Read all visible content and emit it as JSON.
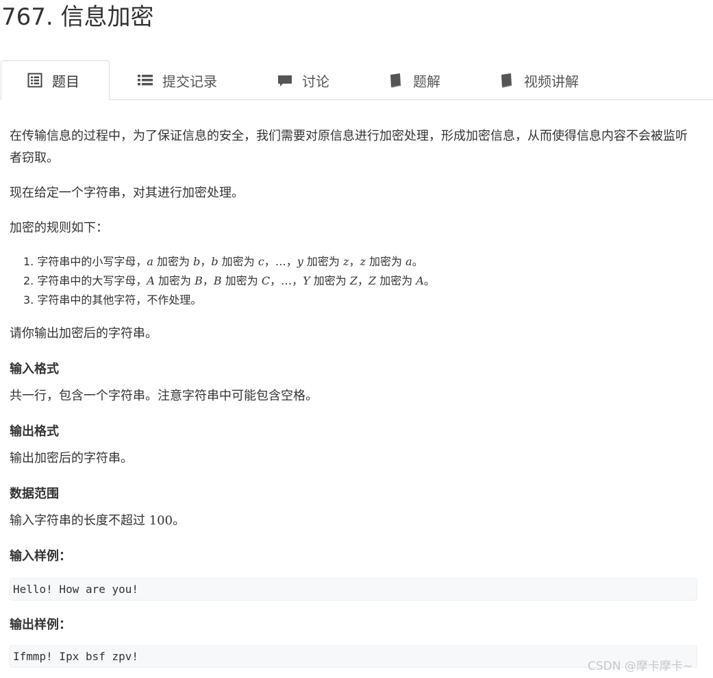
{
  "problem": {
    "title": "767. 信息加密"
  },
  "tabs": [
    {
      "label": "题目",
      "icon": "list-alt-icon",
      "active": true
    },
    {
      "label": "提交记录",
      "icon": "list-icon",
      "active": false
    },
    {
      "label": "讨论",
      "icon": "comment-icon",
      "active": false
    },
    {
      "label": "题解",
      "icon": "book-icon",
      "active": false
    },
    {
      "label": "视频讲解",
      "icon": "book-icon",
      "active": false
    }
  ],
  "description": {
    "p1": "在传输信息的过程中，为了保证信息的安全，我们需要对原信息进行加密处理，形成加密信息，从而使得信息内容不会被监听者窃取。",
    "p2": "现在给定一个字符串，对其进行加密处理。",
    "p3": "加密的规则如下：",
    "rules": [
      {
        "num": "1.",
        "prefix": "字符串中的小写字母，",
        "a": "a",
        "t1": " 加密为 ",
        "b": "b",
        "sep1": "，",
        "b2": "b",
        "t2": " 加密为 ",
        "c": "c",
        "dots": "，…，",
        "y": "y",
        "t3": " 加密为 ",
        "z": "z",
        "sep2": "，",
        "z2": "z",
        "t4": " 加密为 ",
        "a2": "a",
        "end": "。"
      },
      {
        "num": "2.",
        "prefix": "字符串中的大写字母，",
        "a": "A",
        "t1": " 加密为 ",
        "b": "B",
        "sep1": "，",
        "b2": "B",
        "t2": " 加密为 ",
        "c": "C",
        "dots": "，…，",
        "y": "Y",
        "t3": " 加密为 ",
        "z": "Z",
        "sep2": "，",
        "z2": "Z",
        "t4": " 加密为 ",
        "a2": "A",
        "end": "。"
      },
      {
        "num": "3.",
        "text": "字符串中的其他字符，不作处理。"
      }
    ],
    "p4": "请你输出加密后的字符串。"
  },
  "input_format": {
    "heading": "输入格式",
    "text": "共一行，包含一个字符串。注意字符串中可能包含空格。"
  },
  "output_format": {
    "heading": "输出格式",
    "text": "输出加密后的字符串。"
  },
  "data_range": {
    "heading": "数据范围",
    "text_prefix": "输入字符串的长度不超过 ",
    "limit": "100",
    "text_suffix": "。"
  },
  "sample_input": {
    "heading": "输入样例：",
    "code": "Hello! How are you!"
  },
  "sample_output": {
    "heading": "输出样例：",
    "code": "Ifmmp! Ipx bsf zpv!"
  },
  "watermark": "CSDN @摩卡摩卡~"
}
